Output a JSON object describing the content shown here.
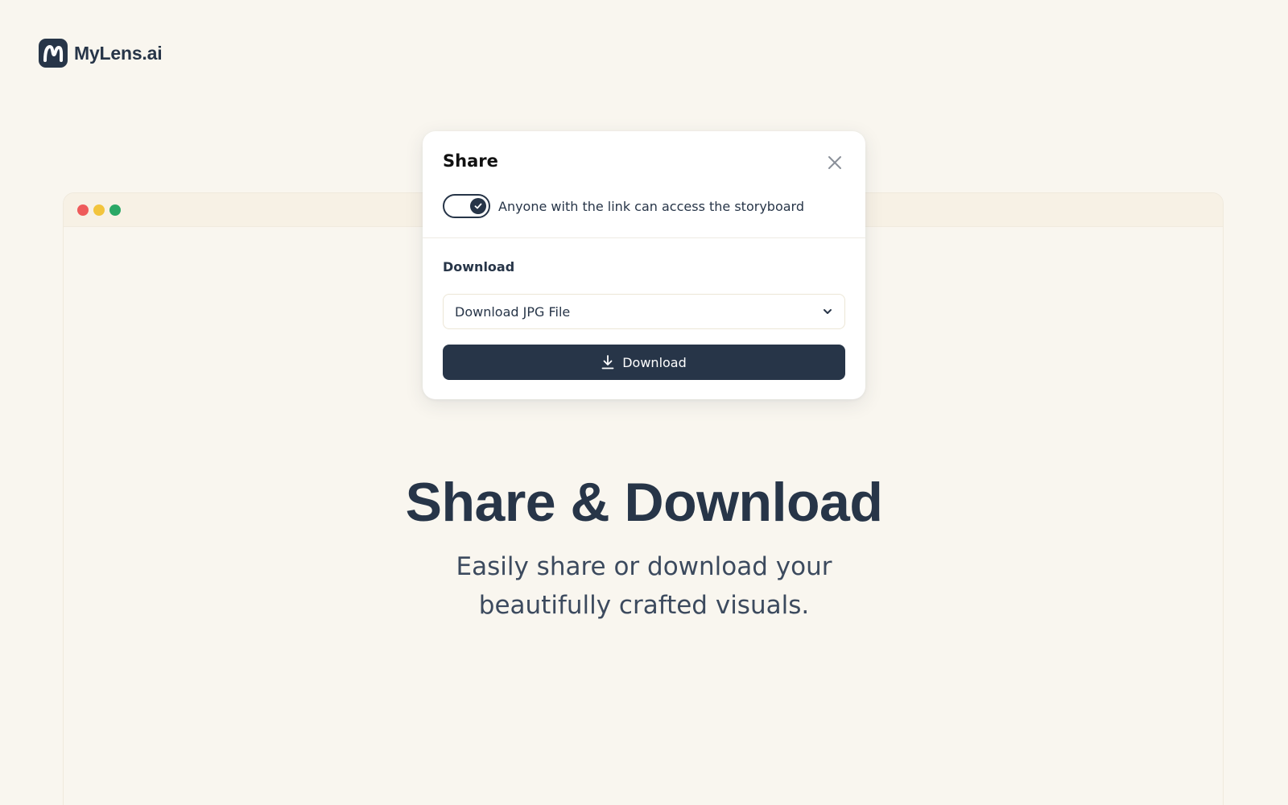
{
  "brand": {
    "name": "MyLens.ai",
    "logo_icon": "mylens-m-icon"
  },
  "browser": {
    "dots": {
      "red": "#ee5b5b",
      "yellow": "#f2c43d",
      "green": "#2aa866"
    }
  },
  "modal": {
    "title": "Share",
    "close_icon": "close-icon",
    "toggle": {
      "label": "Anyone with the link can access the storyboard",
      "on": true
    },
    "download_section": {
      "label": "Download",
      "select_value": "Download JPG File",
      "select_icon": "chevron-down-icon",
      "button_label": "Download",
      "button_icon": "download-icon"
    }
  },
  "hero": {
    "title": "Share & Download",
    "subtitle_line1": "Easily share or download your",
    "subtitle_line2": "beautifully crafted visuals."
  },
  "colors": {
    "background": "#f9f6ef",
    "primary": "#273548"
  }
}
